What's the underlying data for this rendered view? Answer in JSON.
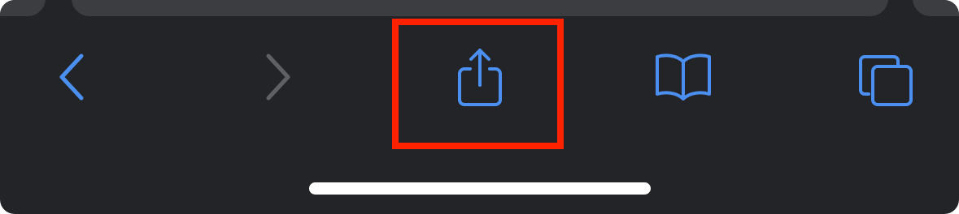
{
  "toolbar": {
    "accent_color": "#4b8ff0",
    "disabled_color": "#5e6064",
    "background_color": "#232427",
    "buttons": [
      {
        "id": "back",
        "icon": "chevron-left-icon",
        "enabled": true
      },
      {
        "id": "forward",
        "icon": "chevron-right-icon",
        "enabled": false
      },
      {
        "id": "share",
        "icon": "share-icon",
        "enabled": true,
        "highlighted": true
      },
      {
        "id": "bookmarks",
        "icon": "open-book-icon",
        "enabled": true
      },
      {
        "id": "tabs",
        "icon": "tabs-icon",
        "enabled": true
      }
    ]
  },
  "annotation": {
    "highlight_color": "#ff2200",
    "target": "share"
  }
}
